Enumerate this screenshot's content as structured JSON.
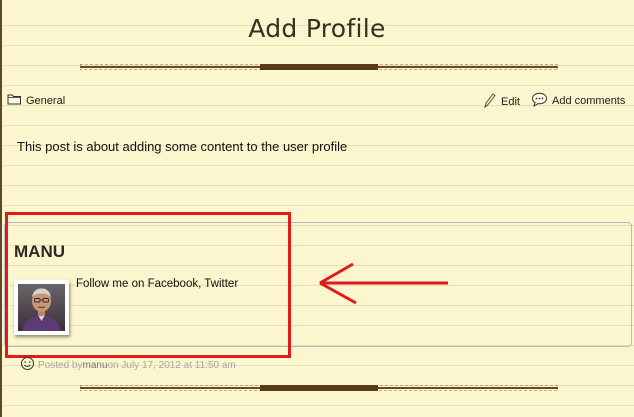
{
  "page": {
    "title": "Add Profile"
  },
  "meta": {
    "category": "General",
    "edit_label": "Edit",
    "comments_label": "Add comments"
  },
  "post": {
    "body": "This post is about adding some content to the user profile"
  },
  "author": {
    "name": "MANU",
    "bio_prefix": "Follow me on ",
    "facebook_label": "Facebook",
    "separator": ", ",
    "twitter_label": "Twitter"
  },
  "footer": {
    "posted_by_prefix": "Posted by ",
    "author": "manu",
    "date_text": " on July 17, 2012 at 11:50 am"
  },
  "colors": {
    "background": "#fbf6cd",
    "annotation_red": "#e01b1b",
    "title_brown": "#3a2e1e"
  },
  "icons": {
    "category": "folder-icon",
    "edit": "pencil-icon",
    "comments": "speech-bubble-icon",
    "posted_by": "smiley-icon"
  }
}
